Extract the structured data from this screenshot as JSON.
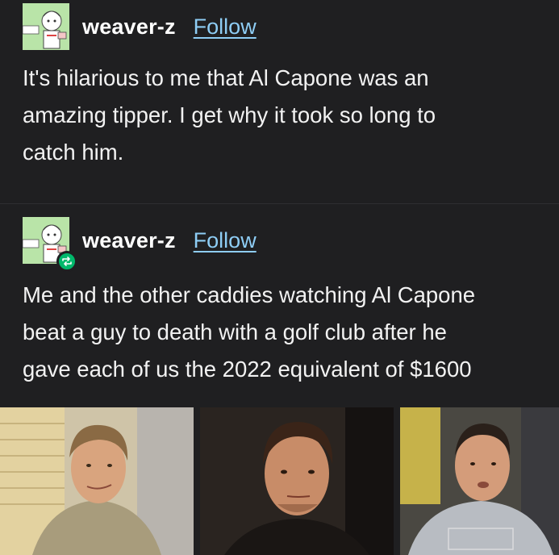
{
  "post1": {
    "username": "weaver-z",
    "follow_label": "Follow",
    "lines": [
      "It's hilarious to me that Al Capone was an",
      "amazing tipper. I get why it took so long to",
      "catch him."
    ]
  },
  "post2": {
    "username": "weaver-z",
    "follow_label": "Follow",
    "reblog_icon": "reblog-icon",
    "lines": [
      "Me and the other caddies watching Al Capone",
      "beat a guy to death with a golf club after he",
      "gave each of us the 2022 equivalent of $1600"
    ]
  },
  "photos": [
    {
      "subject": "man-with-smirk"
    },
    {
      "subject": "man-serious-stare"
    },
    {
      "subject": "man-in-gray-shirt"
    }
  ],
  "colors": {
    "background": "#1f1f21",
    "link": "#8ecdf5",
    "reblog_badge": "#00b86b",
    "avatar_bg": "#b9e4a8"
  }
}
